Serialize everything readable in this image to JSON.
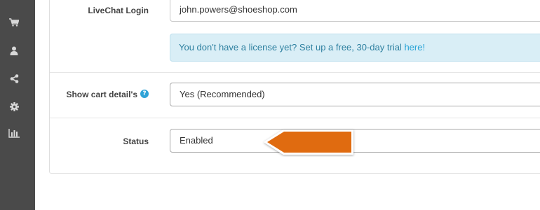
{
  "sidebar": {
    "items": [
      {
        "icon": "cart-icon"
      },
      {
        "icon": "user-icon"
      },
      {
        "icon": "share-icon"
      },
      {
        "icon": "gear-icon"
      },
      {
        "icon": "bar-chart-icon"
      }
    ]
  },
  "form": {
    "livechat_login": {
      "label": "LiveChat Login",
      "value": "john.powers@shoeshop.com"
    },
    "license_notice": {
      "text": "You don't have a license yet? Set up a free, 30-day trial ",
      "link": "here!"
    },
    "show_cart_details": {
      "label": "Show cart detail's",
      "help_icon": "?",
      "selected": "Yes (Recommended)"
    },
    "status": {
      "label": "Status",
      "selected": "Enabled"
    }
  },
  "colors": {
    "sidebar_bg": "#4a4a4a",
    "alert_bg": "#d9eef6",
    "alert_text": "#2e80a0",
    "link": "#27a3d6",
    "arrow": "#e06b10"
  }
}
